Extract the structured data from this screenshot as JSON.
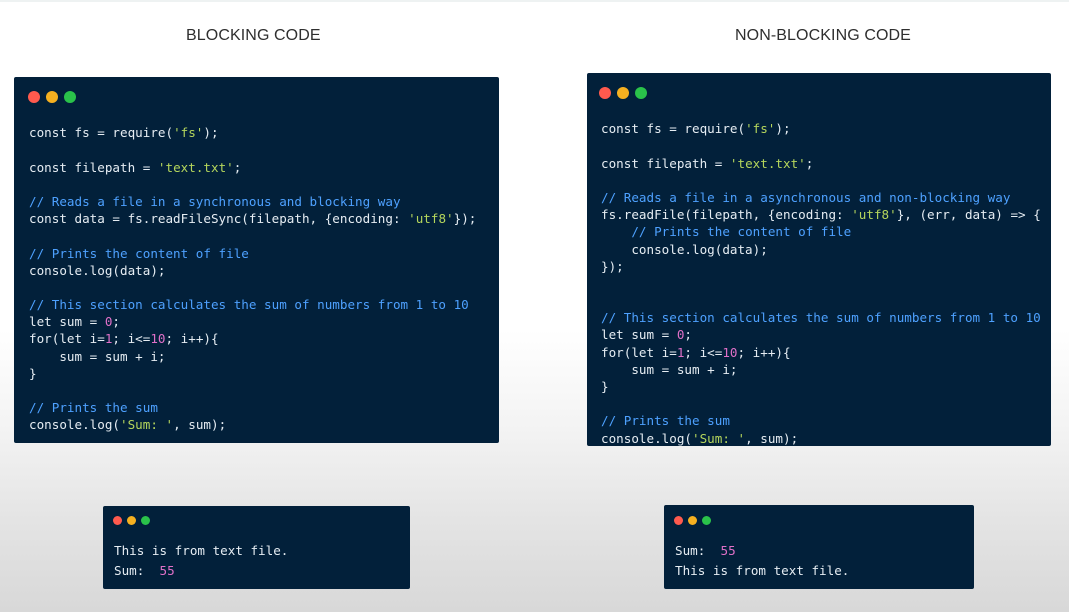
{
  "titles": {
    "left": "BLOCKING CODE",
    "right": "NON-BLOCKING CODE"
  },
  "colors": {
    "panel_bg": "#02203a",
    "dot_red": "#ff5a4e",
    "dot_yellow": "#f5b020",
    "dot_green": "#2ac24a",
    "comment": "#4ea1ff",
    "string": "#b5d65c",
    "number": "#e070c8",
    "text": "#e6edf3"
  },
  "blocking_code": [
    [],
    [
      [
        "t",
        "const fs = require("
      ],
      [
        "s",
        "'fs'"
      ],
      [
        "t",
        ");"
      ]
    ],
    [],
    [
      [
        "t",
        "const filepath = "
      ],
      [
        "s",
        "'text.txt'"
      ],
      [
        "t",
        ";"
      ]
    ],
    [],
    [
      [
        "c",
        "// Reads a file in a synchronous and blocking way"
      ]
    ],
    [
      [
        "t",
        "const data = fs.readFileSync(filepath, {encoding: "
      ],
      [
        "s",
        "'utf8'"
      ],
      [
        "t",
        "});"
      ]
    ],
    [],
    [
      [
        "c",
        "// Prints the content of file"
      ]
    ],
    [
      [
        "t",
        "console.log(data);"
      ]
    ],
    [],
    [
      [
        "c",
        "// This section calculates the sum of numbers from 1 to 10"
      ]
    ],
    [
      [
        "t",
        "let sum = "
      ],
      [
        "n",
        "0"
      ],
      [
        "t",
        ";"
      ]
    ],
    [
      [
        "t",
        "for(let i="
      ],
      [
        "n",
        "1"
      ],
      [
        "t",
        "; i<="
      ],
      [
        "n",
        "10"
      ],
      [
        "t",
        "; i++){"
      ]
    ],
    [
      [
        "t",
        "    sum = sum + i;"
      ]
    ],
    [
      [
        "t",
        "}"
      ]
    ],
    [],
    [
      [
        "c",
        "// Prints the sum"
      ]
    ],
    [
      [
        "t",
        "console.log("
      ],
      [
        "s",
        "'Sum: '"
      ],
      [
        "t",
        ", sum);"
      ]
    ]
  ],
  "nonblocking_code": [
    [],
    [
      [
        "t",
        "const fs = require("
      ],
      [
        "s",
        "'fs'"
      ],
      [
        "t",
        ");"
      ]
    ],
    [],
    [
      [
        "t",
        "const filepath = "
      ],
      [
        "s",
        "'text.txt'"
      ],
      [
        "t",
        ";"
      ]
    ],
    [],
    [
      [
        "c",
        "// Reads a file in a asynchronous and non-blocking way"
      ]
    ],
    [
      [
        "t",
        "fs.readFile(filepath, {encoding: "
      ],
      [
        "s",
        "'utf8'"
      ],
      [
        "t",
        "}, (err, data) => {"
      ]
    ],
    [
      [
        "t",
        "    "
      ],
      [
        "c",
        "// Prints the content of file"
      ]
    ],
    [
      [
        "t",
        "    console.log(data);"
      ]
    ],
    [
      [
        "t",
        "});"
      ]
    ],
    [],
    [],
    [
      [
        "c",
        "// This section calculates the sum of numbers from 1 to 10"
      ]
    ],
    [
      [
        "t",
        "let sum = "
      ],
      [
        "n",
        "0"
      ],
      [
        "t",
        ";"
      ]
    ],
    [
      [
        "t",
        "for(let i="
      ],
      [
        "n",
        "1"
      ],
      [
        "t",
        "; i<="
      ],
      [
        "n",
        "10"
      ],
      [
        "t",
        "; i++){"
      ]
    ],
    [
      [
        "t",
        "    sum = sum + i;"
      ]
    ],
    [
      [
        "t",
        "}"
      ]
    ],
    [],
    [
      [
        "c",
        "// Prints the sum"
      ]
    ],
    [
      [
        "t",
        "console.log("
      ],
      [
        "s",
        "'Sum: '"
      ],
      [
        "t",
        ", sum);"
      ]
    ]
  ],
  "blocking_output": [
    [
      [
        "t",
        "This is from text file."
      ]
    ],
    [
      [
        "t",
        "Sum:  "
      ],
      [
        "n",
        "55"
      ]
    ]
  ],
  "nonblocking_output": [
    [
      [
        "t",
        "Sum:  "
      ],
      [
        "n",
        "55"
      ]
    ],
    [
      [
        "t",
        "This is from text file."
      ]
    ]
  ]
}
